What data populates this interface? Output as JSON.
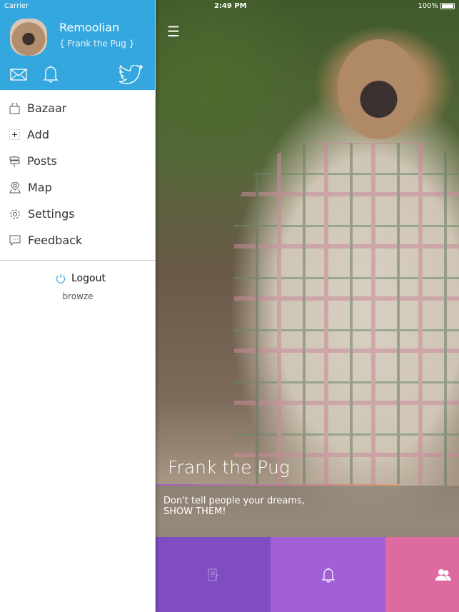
{
  "status_bar": {
    "carrier": "Carrier",
    "time": "2:49 PM",
    "battery": "100%"
  },
  "drawer": {
    "user_name": "Remoolian",
    "dog_name": "{ Frank the Pug }",
    "header_icons": [
      "mail-icon",
      "bell-icon",
      "twitter-icon"
    ],
    "menu": [
      {
        "label": "Bazaar",
        "icon": "shopping-bag-icon"
      },
      {
        "label": "Add",
        "icon": "plus-icon"
      },
      {
        "label": "Posts",
        "icon": "signpost-icon"
      },
      {
        "label": "Map",
        "icon": "map-pin-icon"
      },
      {
        "label": "Settings",
        "icon": "gear-icon"
      },
      {
        "label": "Feedback",
        "icon": "chat-icon"
      }
    ],
    "logout_label": "Logout",
    "footer": "browze"
  },
  "main": {
    "dog_name": "Frank the Pug",
    "quote_line1": "Don't tell people your dreams,",
    "quote_line2": "SHOW THEM!",
    "tabs": [
      {
        "icon": "posts-icon",
        "color": "#7f4cc2"
      },
      {
        "icon": "bell-icon",
        "color": "#a25fd6"
      },
      {
        "icon": "friends-icon",
        "color": "#dd6aa0"
      }
    ]
  },
  "colors": {
    "header": "#35a7df",
    "logout_icon": "#35a7df"
  }
}
